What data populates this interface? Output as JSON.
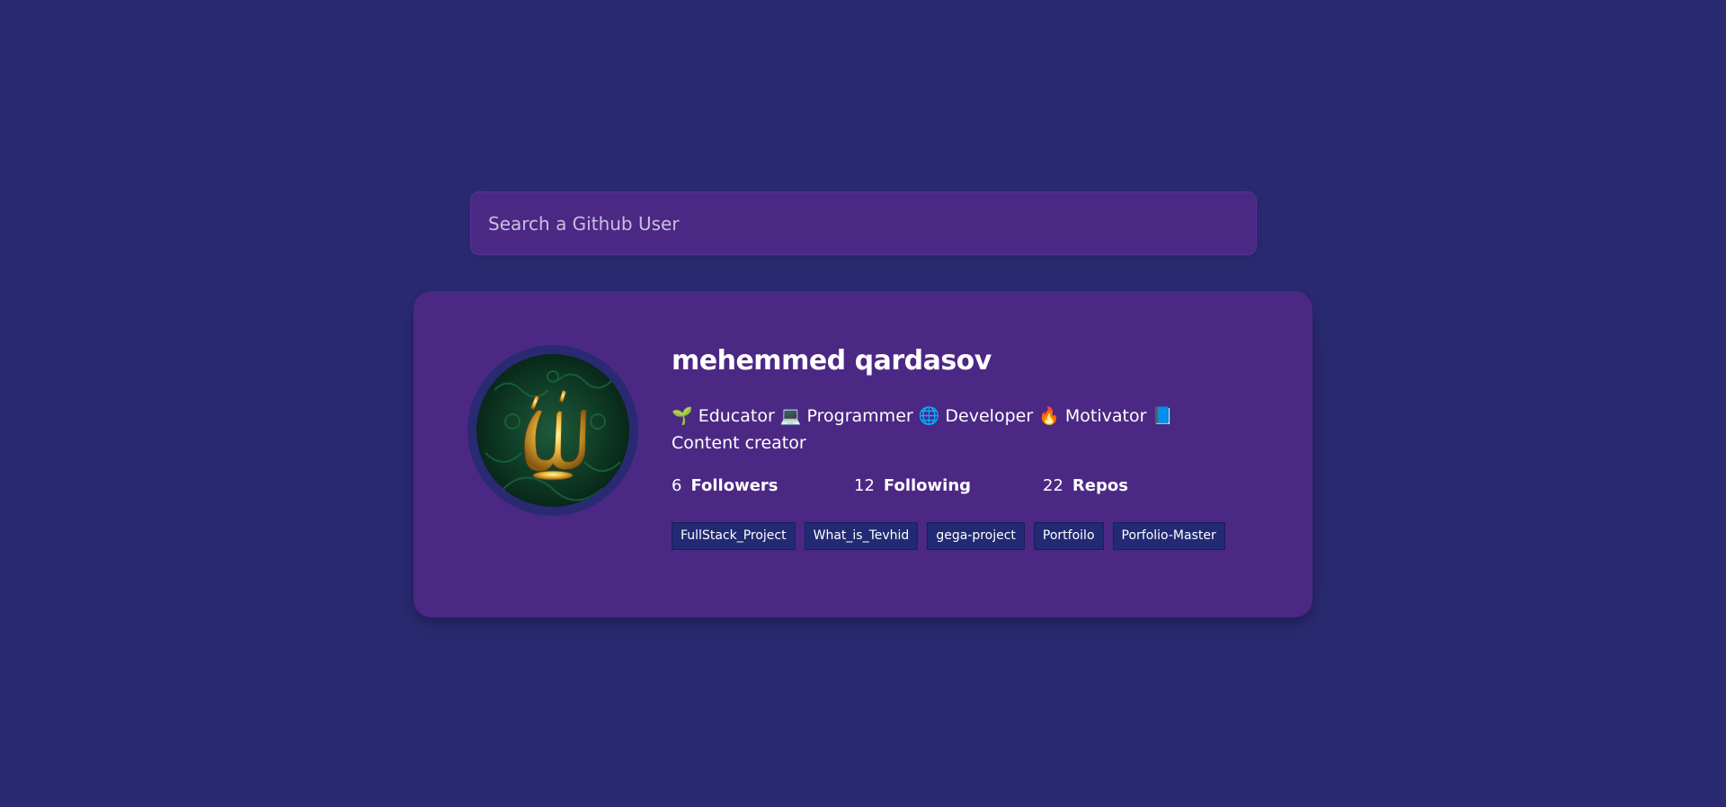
{
  "search": {
    "placeholder": "Search a Github User",
    "value": ""
  },
  "profile": {
    "avatar_icon": "calligraphy-avatar-image",
    "name": "mehemmed qardasov",
    "bio": "🌱 Educator 💻 Programmer 🌐 Developer 🔥 Motivator 📘 Content creator",
    "stats": {
      "followers_count": "6",
      "followers_label": "Followers",
      "following_count": "12",
      "following_label": "Following",
      "repos_count": "22",
      "repos_label": "Repos"
    },
    "repos": [
      {
        "name": "FullStack_Project"
      },
      {
        "name": "What_is_Tevhid"
      },
      {
        "name": "gega-project"
      },
      {
        "name": "Portfoilo"
      },
      {
        "name": "Porfolio-Master"
      }
    ]
  },
  "colors": {
    "background": "#2a2a72",
    "card": "#4c2885",
    "repo_tag": "#212a72",
    "text": "#ffffff"
  }
}
